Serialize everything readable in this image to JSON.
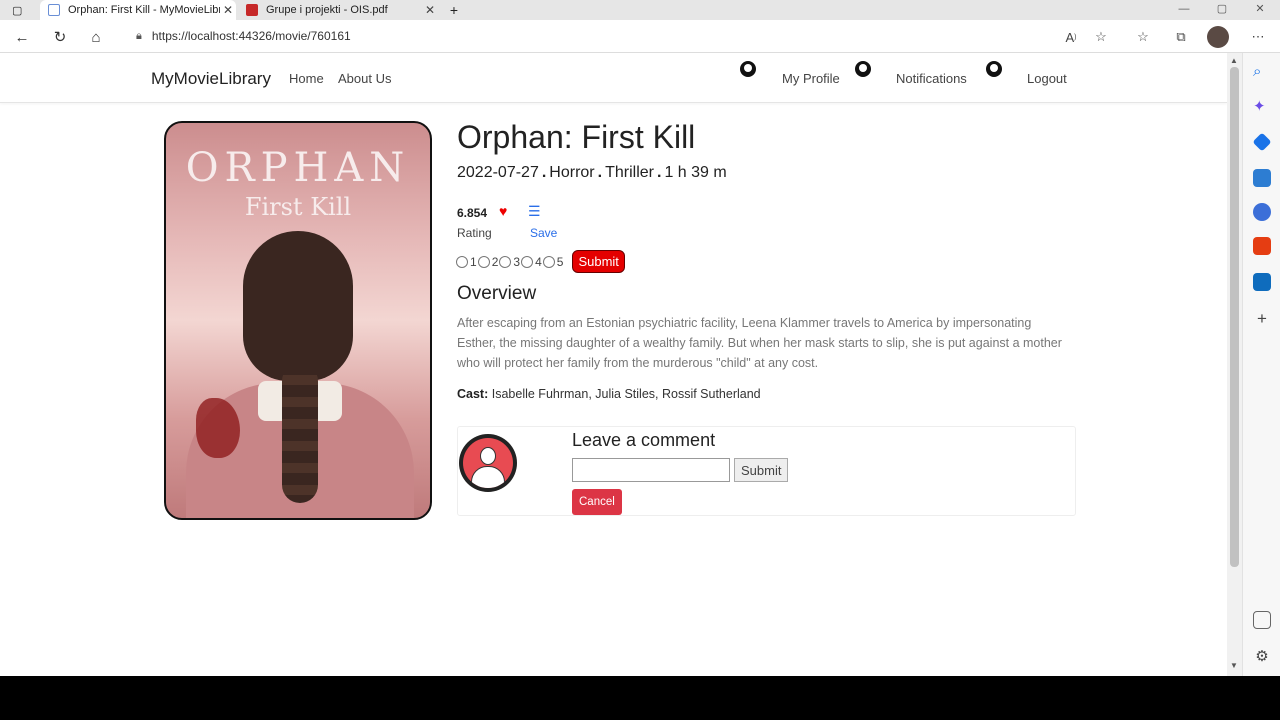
{
  "browser": {
    "tabs": [
      {
        "title": "Orphan: First Kill - MyMovieLibrary"
      },
      {
        "title": "Grupe i projekti - OIS.pdf"
      }
    ],
    "url": "https://localhost:44326/movie/760161"
  },
  "nav": {
    "brand": "MyMovieLibrary",
    "home": "Home",
    "about": "About Us",
    "profile": "My Profile",
    "notifications": "Notifications",
    "logout": "Logout"
  },
  "poster": {
    "title": "ORPHAN",
    "subtitle": "First Kill"
  },
  "movie": {
    "title": "Orphan: First Kill",
    "date": "2022-07-27",
    "genre1": "Horror",
    "genre2": "Thriller",
    "runtime": "1 h 39 m",
    "sep": ".",
    "rating": "6.854",
    "rating_label": "Rating",
    "save_label": "Save",
    "rating_options": [
      "1",
      "2",
      "3",
      "4",
      "5"
    ],
    "submit_label": "Submit",
    "overview_heading": "Overview",
    "overview": "After escaping from an Estonian psychiatric facility, Leena Klammer travels to America by impersonating Esther, the missing daughter of a wealthy family. But when her mask starts to slip, she is put against a mother who will protect her family from the murderous \"child\" at any cost.",
    "cast_label": "Cast:",
    "cast": "Isabelle Fuhrman, Julia Stiles, Rossif Sutherland"
  },
  "comment": {
    "heading": "Leave a comment",
    "input_value": "",
    "submit": "Submit",
    "cancel": "Cancel"
  },
  "colors": {
    "accent_red": "#e40000",
    "cancel_red": "#dc3545",
    "link_blue": "#2a6ee8"
  }
}
